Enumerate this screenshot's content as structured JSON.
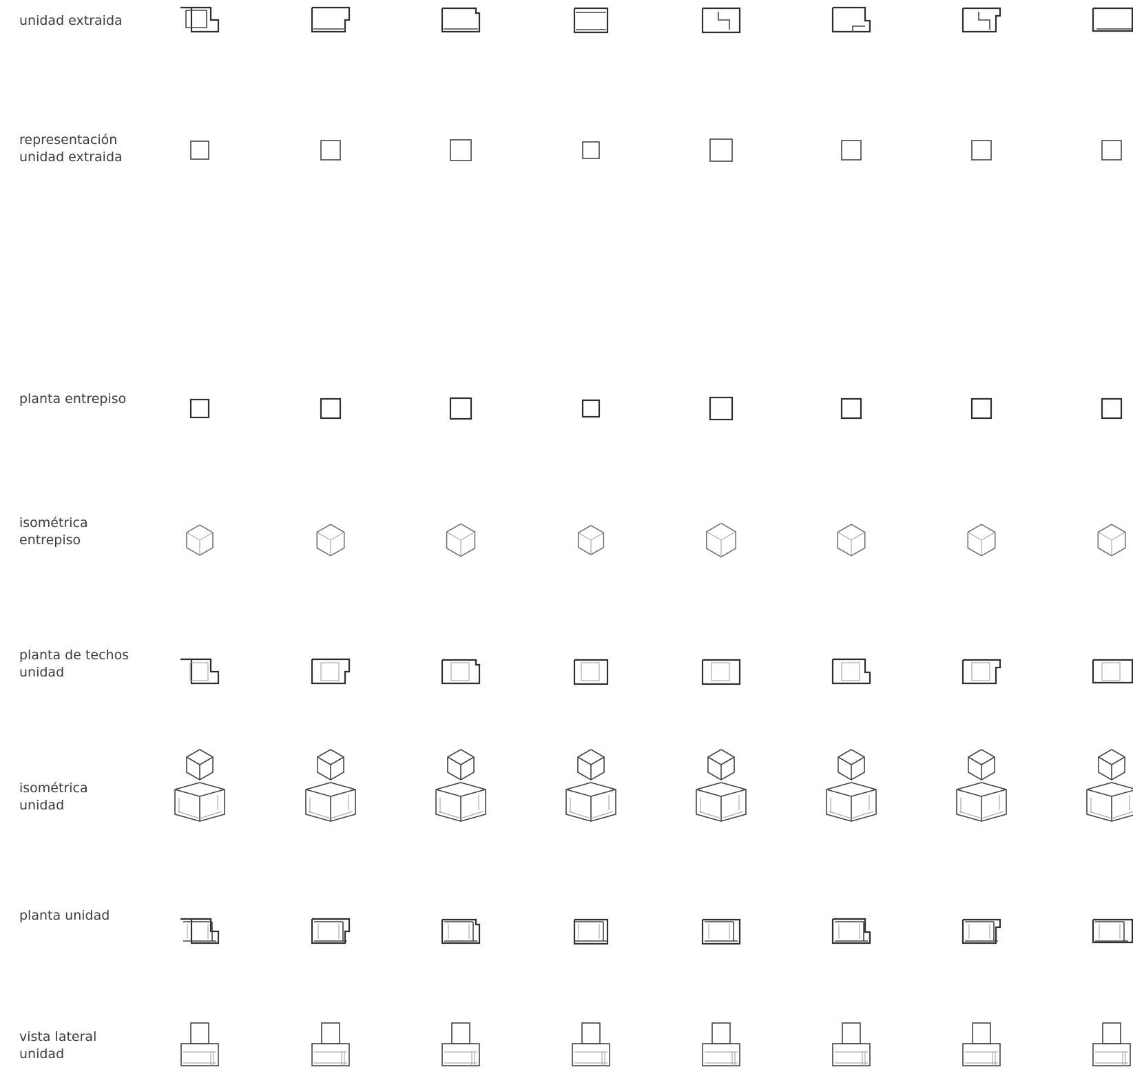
{
  "rows": [
    {
      "id": "unidad-extraida",
      "label": "unidad extraida"
    },
    {
      "id": "representacion-unidad-extraida",
      "label": "representación\nunidad extraida"
    },
    {
      "id": "planta-entrepiso",
      "label": "planta entrepiso"
    },
    {
      "id": "isometrica-entrepiso",
      "label": "isométrica\nentrepiso"
    },
    {
      "id": "planta-de-techos-unidad",
      "label": "planta de techos\nunidad"
    },
    {
      "id": "isometrica-unidad",
      "label": "isométrica\nunidad"
    },
    {
      "id": "planta-unidad",
      "label": "planta unidad"
    },
    {
      "id": "vista-lateral-unidad",
      "label": "vista lateral\nunidad"
    }
  ],
  "column_count": 8,
  "colors": {
    "text": "#3c3c3c",
    "line": "#444444",
    "light_line": "#9a9a9a"
  }
}
